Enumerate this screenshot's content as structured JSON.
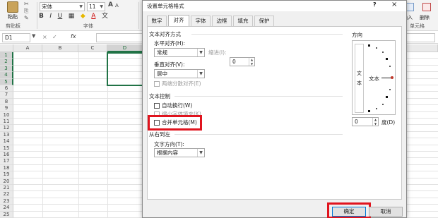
{
  "ribbon": {
    "paste_label": "粘贴",
    "clipboard_group": "剪贴板",
    "font_name": "宋体",
    "font_size": "11",
    "font_group": "字体",
    "bold": "B",
    "italic": "I",
    "underline": "U",
    "grow_font": "A",
    "shrink_font": "A",
    "wen": "文",
    "right_insert_label": "插入",
    "right_delete_label": "删除",
    "cells_group": "单元格"
  },
  "formula_bar": {
    "name_box": "D1",
    "cancel": "×",
    "enter": "✓",
    "fx": "fx"
  },
  "sheet": {
    "columns": [
      "A",
      "B",
      "C",
      "D"
    ],
    "selected_column": "D",
    "rows": [
      "1",
      "2",
      "3",
      "4",
      "5",
      "6",
      "7",
      "8",
      "9",
      "10",
      "11",
      "12",
      "13",
      "14",
      "15",
      "16",
      "17",
      "18",
      "19",
      "20",
      "21",
      "22",
      "23",
      "24",
      "25"
    ]
  },
  "dialog": {
    "title": "设置单元格格式",
    "help": "?",
    "close": "×",
    "tabs": [
      "数字",
      "对齐",
      "字体",
      "边框",
      "填充",
      "保护"
    ],
    "active_tab": "对齐",
    "text_alignment": {
      "section": "文本对齐方式",
      "horizontal_label": "水平对齐(H):",
      "horizontal_value": "常规",
      "indent_label": "缩进(I):",
      "indent_value": "0",
      "vertical_label": "垂直对齐(V):",
      "vertical_value": "居中",
      "justify_distributed": "两端分散对齐(E)"
    },
    "text_control": {
      "section": "文本控制",
      "wrap_text": "自动换行(W)",
      "shrink_to_fit": "缩小字体填充(K)",
      "merge_cells": "合并单元格(M)"
    },
    "rtl": {
      "section": "从右到左",
      "direction_label": "文字方向(T):",
      "direction_value": "根据内容"
    },
    "orientation": {
      "section": "方向",
      "vertical_text_1": "文",
      "vertical_text_2": "本",
      "text_label": "文本",
      "degrees_value": "0",
      "degrees_label": "度(D)"
    },
    "buttons": {
      "ok": "确定",
      "cancel": "取消"
    },
    "highlight_color": "#e0141e"
  }
}
